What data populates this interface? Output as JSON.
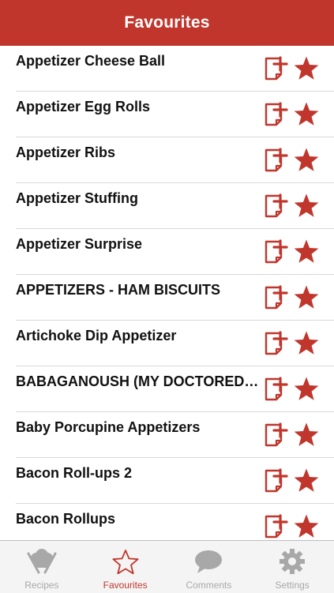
{
  "navbar": {
    "title": "Favourites"
  },
  "recipes": [
    {
      "label": "Appetizer Cheese Ball"
    },
    {
      "label": "Appetizer Egg Rolls"
    },
    {
      "label": "Appetizer Ribs"
    },
    {
      "label": "Appetizer Stuffing"
    },
    {
      "label": "Appetizer Surprise"
    },
    {
      "label": "APPETIZERS - HAM BISCUITS"
    },
    {
      "label": "Artichoke Dip Appetizer"
    },
    {
      "label": "BABAGANOUSH (MY DOCTORED VERSION)"
    },
    {
      "label": "Baby Porcupine Appetizers"
    },
    {
      "label": "Bacon Roll-ups 2"
    },
    {
      "label": "Bacon Rollups"
    }
  ],
  "row_icons": {
    "add_note": "add-note-icon",
    "favourite": "star-icon"
  },
  "tabbar": {
    "tabs": [
      {
        "label": "Recipes",
        "icon": "chef-hat-utensils-icon",
        "active": false
      },
      {
        "label": "Favourites",
        "icon": "star-outline-icon",
        "active": true
      },
      {
        "label": "Comments",
        "icon": "speech-bubble-icon",
        "active": false
      },
      {
        "label": "Settings",
        "icon": "gear-icon",
        "active": false
      }
    ]
  },
  "colors": {
    "brand": "#c0362c",
    "tab_inactive": "#a8a8a8",
    "tabbar_bg": "#f4f4f4"
  }
}
